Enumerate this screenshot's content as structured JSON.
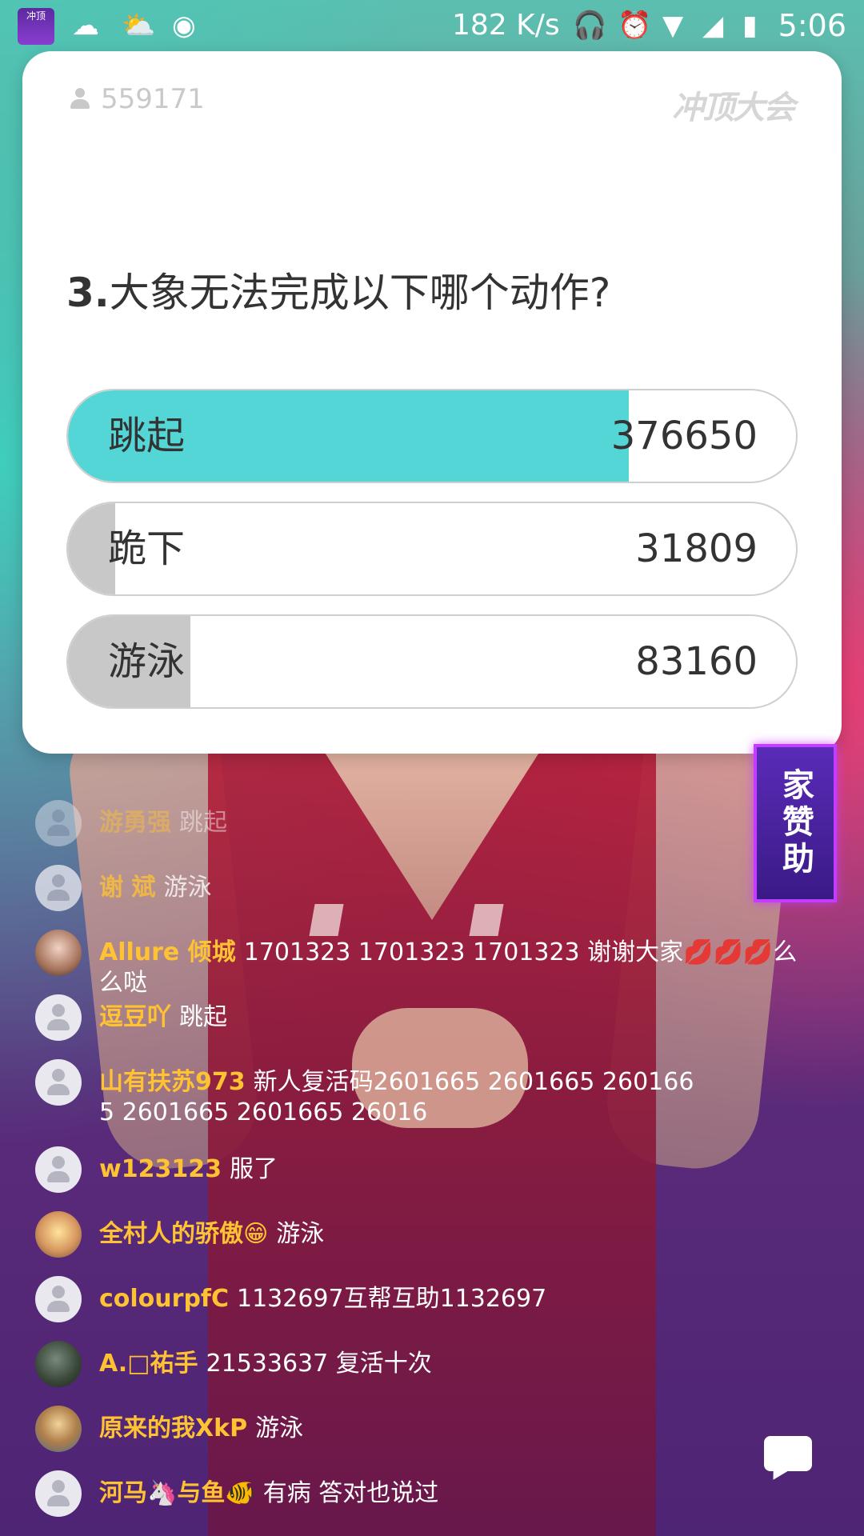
{
  "status_bar": {
    "app_icon_text": "冲顶",
    "network_speed": "182 K/s",
    "time": "5:06",
    "icons": [
      "cloud-rain-icon",
      "cloud-sun-icon",
      "record-icon",
      "headphones-icon",
      "alarm-icon",
      "wifi-icon",
      "signal-icon",
      "battery-charging-icon"
    ]
  },
  "quiz": {
    "viewer_count": "559171",
    "brand": "冲顶大会",
    "question_number": "3.",
    "question_text": "大象无法完成以下哪个动作?",
    "options": [
      {
        "label": "跳起",
        "count": "376650",
        "fill_fraction": 0.77,
        "fill_color": "#55d6d6"
      },
      {
        "label": "跪下",
        "count": "31809",
        "fill_fraction": 0.065,
        "fill_color": "#c8c8c8"
      },
      {
        "label": "游泳",
        "count": "83160",
        "fill_fraction": 0.168,
        "fill_color": "#c8c8c8"
      }
    ]
  },
  "sponsor": {
    "text": "家赞助"
  },
  "chat": [
    {
      "user": "游勇强",
      "message": "跳起",
      "avatar": "default"
    },
    {
      "user": "谢 斌",
      "message": "游泳",
      "avatar": "default"
    },
    {
      "user": "Allure 倾城",
      "message": "1701323 1701323 1701323 谢谢大家💋💋💋么么哒",
      "avatar": "photo1"
    },
    {
      "user": "逗豆吖",
      "message": "跳起",
      "avatar": "default"
    },
    {
      "user": "山有扶苏973",
      "message": "新人复活码2601665 2601665 2601665 2601665 2601665 26016",
      "avatar": "default"
    },
    {
      "user": "w123123",
      "message": "服了",
      "avatar": "default"
    },
    {
      "user": "全村人的骄傲😁",
      "message": "游泳",
      "avatar": "photo2"
    },
    {
      "user": "colourpfC",
      "message": "1132697互帮互助1132697",
      "avatar": "default"
    },
    {
      "user": "A.□祐手",
      "message": "21533637 复活十次",
      "avatar": "photo3"
    },
    {
      "user": "原来的我XkP",
      "message": "游泳",
      "avatar": "photo4"
    },
    {
      "user": "河马🦄与鱼🐠",
      "message": "有病 答对也说过",
      "avatar": "default"
    }
  ],
  "chat_button_icon": "chat-bubble-icon"
}
